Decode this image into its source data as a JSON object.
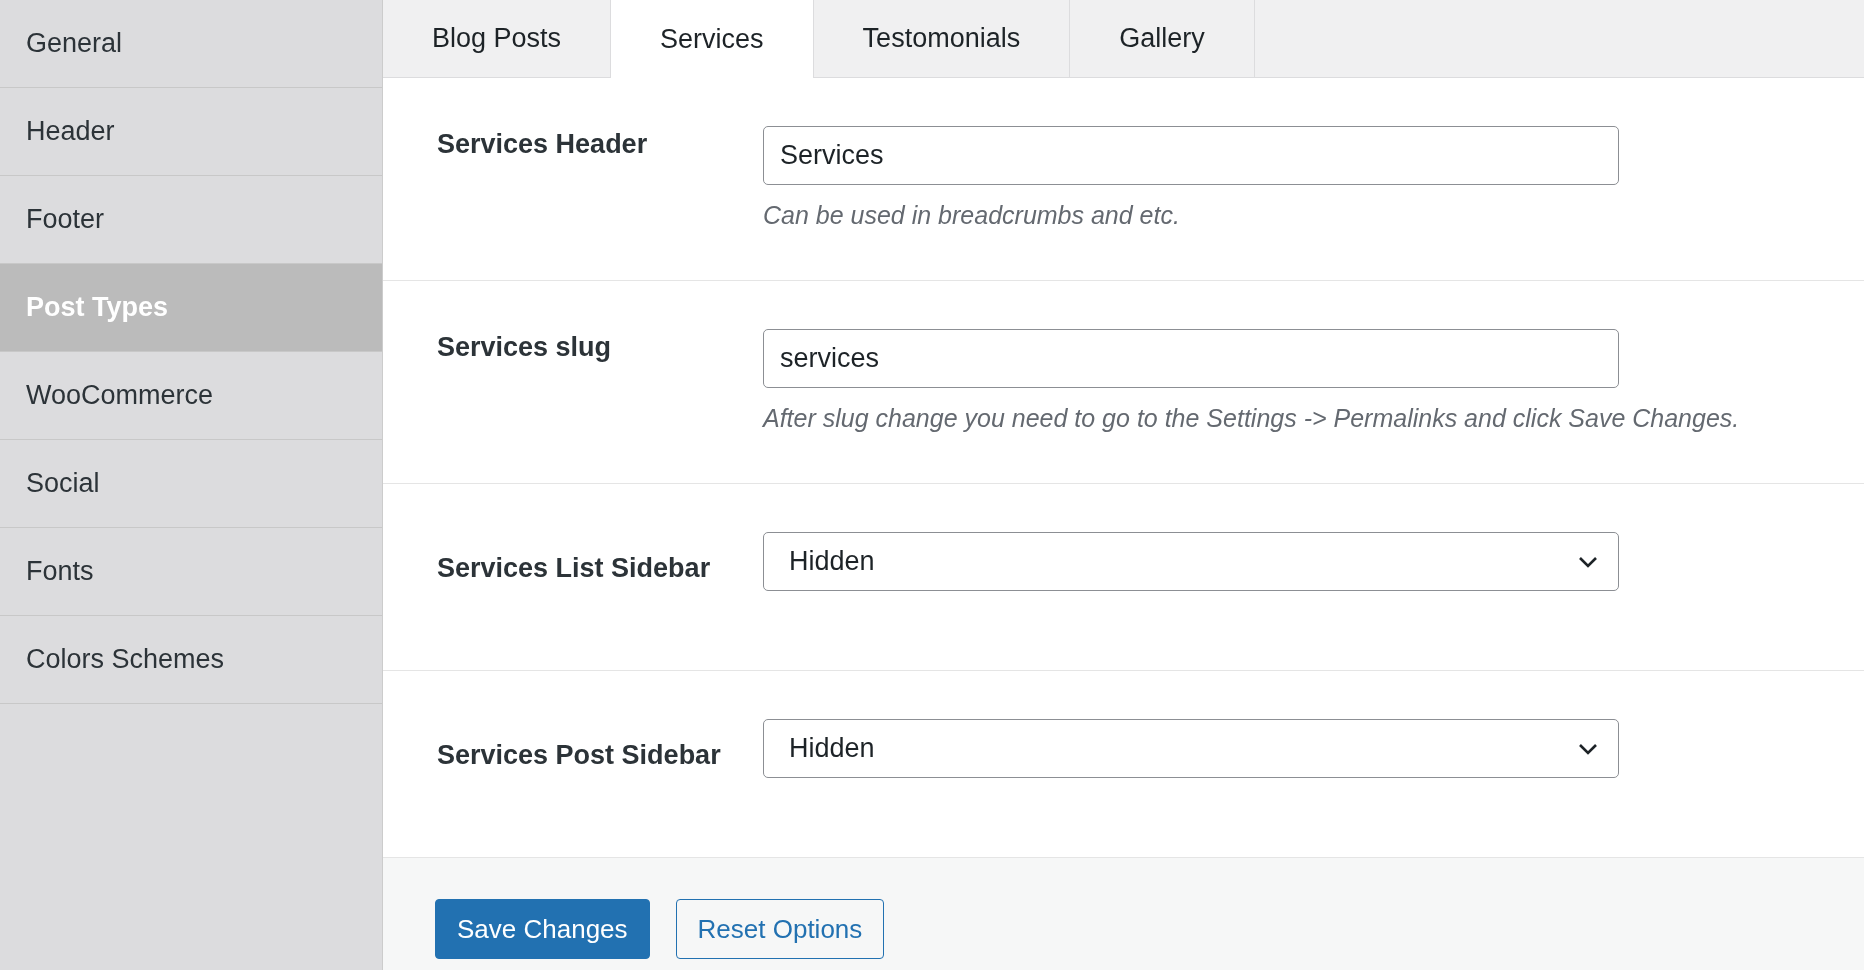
{
  "sidebar": {
    "items": [
      {
        "label": "General",
        "selected": false
      },
      {
        "label": "Header",
        "selected": false
      },
      {
        "label": "Footer",
        "selected": false
      },
      {
        "label": "Post Types",
        "selected": true
      },
      {
        "label": "WooCommerce",
        "selected": false
      },
      {
        "label": "Social",
        "selected": false
      },
      {
        "label": "Fonts",
        "selected": false
      },
      {
        "label": "Colors Schemes",
        "selected": false
      }
    ]
  },
  "tabs": [
    {
      "label": "Blog Posts",
      "selected": false
    },
    {
      "label": "Services",
      "selected": true
    },
    {
      "label": "Testomonials",
      "selected": false
    },
    {
      "label": "Gallery",
      "selected": false
    }
  ],
  "fields": [
    {
      "kind": "text",
      "label": "Services Header",
      "value": "Services",
      "description": "Can be used in breadcrumbs and etc."
    },
    {
      "kind": "text",
      "label": "Services slug",
      "value": "services",
      "description": "After slug change you need to go to the Settings -> Permalinks and click Save Changes."
    },
    {
      "kind": "select",
      "label": "Services List Sidebar",
      "value": "Hidden"
    },
    {
      "kind": "select",
      "label": "Services Post Sidebar",
      "value": "Hidden"
    }
  ],
  "buttons": [
    {
      "kind": "primary",
      "label": "Save Changes"
    },
    {
      "kind": "secondary",
      "label": "Reset Options"
    }
  ]
}
